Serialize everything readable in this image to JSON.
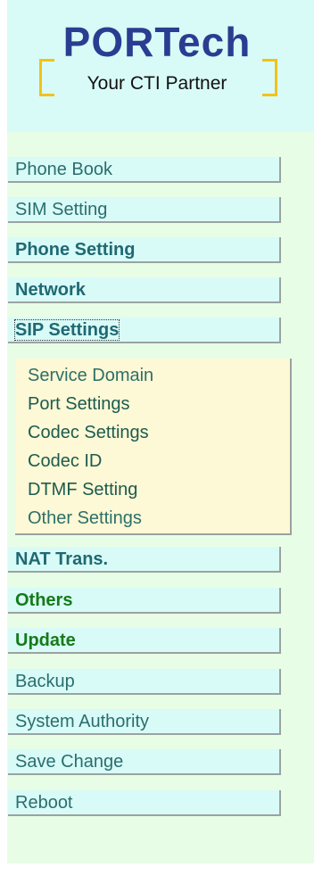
{
  "logo": {
    "title": "PORTech",
    "subtitle": "Your CTI Partner"
  },
  "menu": [
    {
      "label": "Phone Book",
      "style": "normal"
    },
    {
      "label": "SIM Setting",
      "style": "normal"
    },
    {
      "label": "Phone Setting",
      "style": "bold"
    },
    {
      "label": "Network",
      "style": "bold"
    },
    {
      "label": "SIP Settings",
      "style": "bold",
      "expanded": true
    }
  ],
  "sip_submenu": [
    {
      "label": "Service Domain"
    },
    {
      "label": "Port Settings"
    },
    {
      "label": "Codec Settings"
    },
    {
      "label": "Codec ID"
    },
    {
      "label": "DTMF Setting"
    },
    {
      "label": "Other Settings"
    }
  ],
  "menu_after": [
    {
      "label": "NAT Trans.",
      "style": "bold"
    },
    {
      "label": "Others",
      "style": "green"
    },
    {
      "label": "Update",
      "style": "green"
    },
    {
      "label": "Backup",
      "style": "normal"
    },
    {
      "label": "System Authority",
      "style": "normal"
    },
    {
      "label": "Save Change",
      "style": "normal"
    },
    {
      "label": "Reboot",
      "style": "normal"
    }
  ],
  "colors": {
    "panel_bg": "#e8fde6",
    "menu_bg": "#d8fbf7",
    "submenu_bg": "#fdf8d5",
    "logo_blue": "#2b3d91",
    "logo_bracket": "#f2c21a"
  }
}
